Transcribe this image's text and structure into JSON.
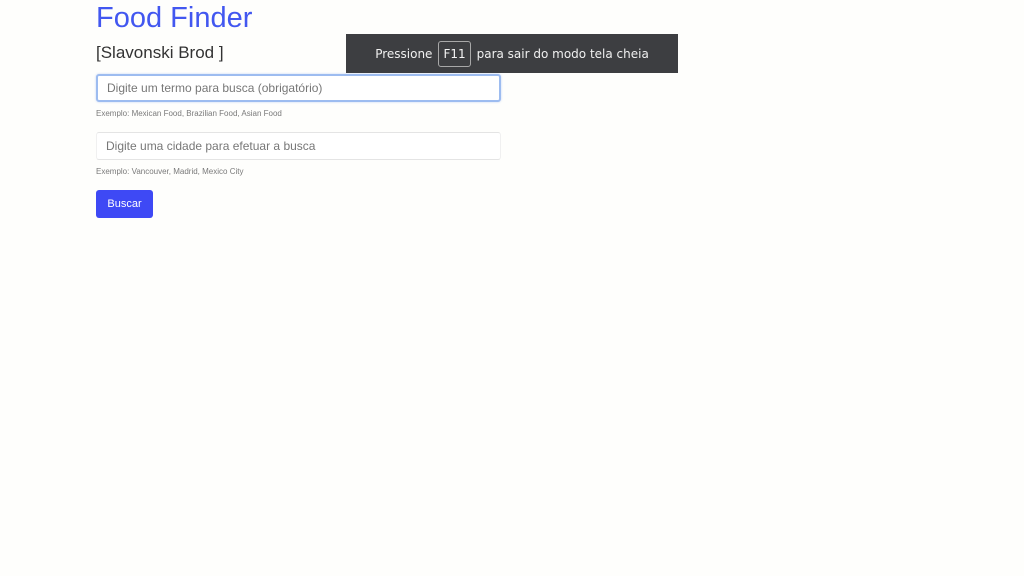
{
  "app": {
    "title": "Food Finder",
    "location": "[Slavonski Brod ]"
  },
  "search": {
    "term_placeholder": "Digite um termo para busca (obrigatório)",
    "term_value": "",
    "term_hint": "Exemplo: Mexican Food, Brazilian Food, Asian Food",
    "city_placeholder": "Digite uma cidade para efetuar a busca",
    "city_value": "",
    "city_hint": "Exemplo: Vancouver, Madrid, Mexico City",
    "button_label": "Buscar"
  },
  "fullscreen_notice": {
    "prefix": "Pressione",
    "key": "F11",
    "suffix": "para sair do modo tela cheia"
  },
  "colors": {
    "title": "#4257f0",
    "button": "#3e49f5",
    "toast_bg": "#3d3e41",
    "focus_border": "#9dbcf0"
  }
}
